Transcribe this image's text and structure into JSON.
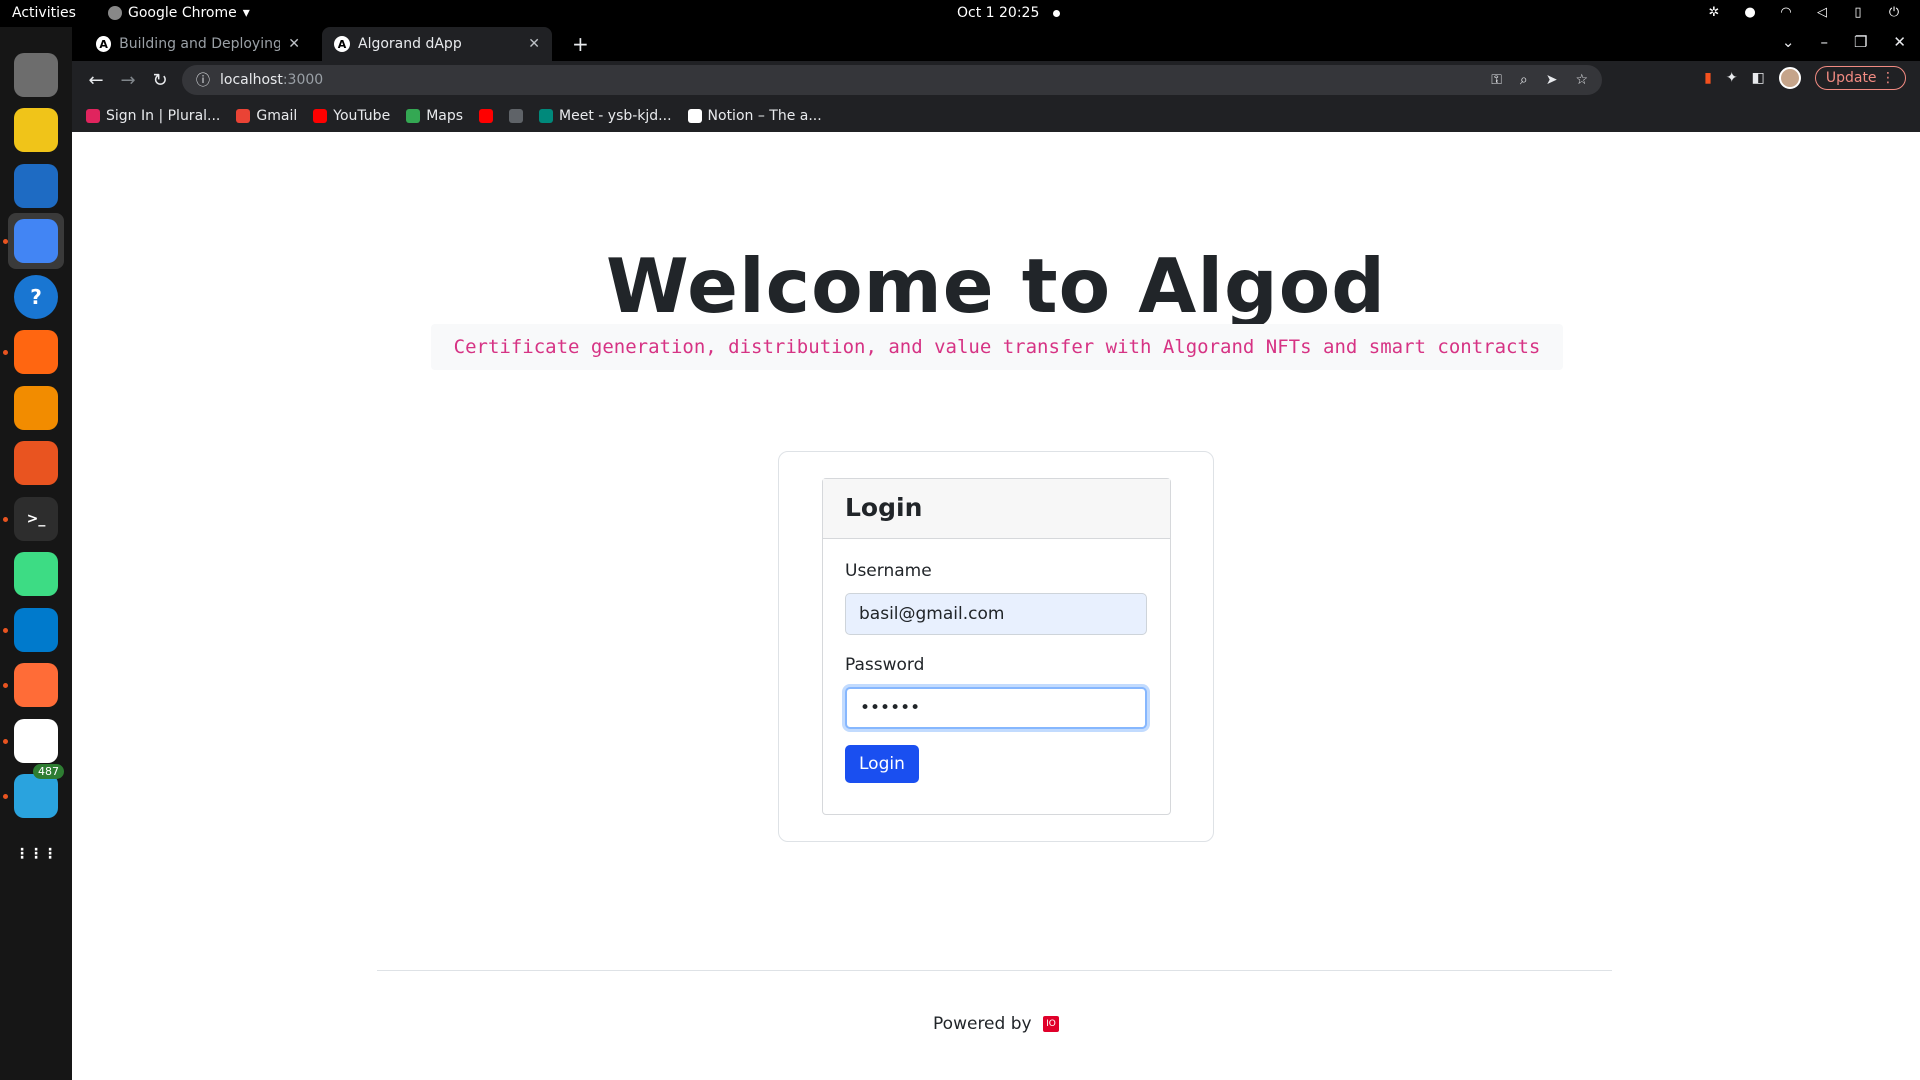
{
  "system": {
    "activities": "Activities",
    "app_name": "Google Chrome",
    "clock": "Oct 1  20:25"
  },
  "dock": {
    "items": [
      {
        "name": "files-icon",
        "color": "#6d6d6d"
      },
      {
        "name": "rhythmbox-icon",
        "color": "#f0c419"
      },
      {
        "name": "libreoffice-writer-icon",
        "color": "#1e6bc3"
      },
      {
        "name": "chrome-icon",
        "color": "#4285f4"
      },
      {
        "name": "help-icon",
        "color": "#1976d2"
      },
      {
        "name": "firefox-icon",
        "color": "#ff6611"
      },
      {
        "name": "vlc-icon",
        "color": "#f28c00"
      },
      {
        "name": "app-center-icon",
        "color": "#e95420"
      },
      {
        "name": "terminal-icon",
        "color": "#2d2d2d"
      },
      {
        "name": "android-studio-icon",
        "color": "#3ddc84"
      },
      {
        "name": "vscode-icon",
        "color": "#007acc"
      },
      {
        "name": "postman-icon",
        "color": "#ff6c37"
      },
      {
        "name": "slack-icon",
        "color": "#ffffff"
      },
      {
        "name": "telegram-icon",
        "color": "#2aa3de"
      },
      {
        "name": "show-apps-icon",
        "color": "#161616"
      }
    ],
    "telegram_badge": "487"
  },
  "browser": {
    "tabs": [
      {
        "title": "Building and Deploying a",
        "active": false
      },
      {
        "title": "Algorand dApp",
        "active": true
      }
    ],
    "url_host": "localhost",
    "url_port": ":3000",
    "update_label": "Update",
    "bookmarks": [
      {
        "label": "Sign In | Plural...",
        "color": "#e0245e"
      },
      {
        "label": "Gmail",
        "color": "#ea4335"
      },
      {
        "label": "YouTube",
        "color": "#ff0000"
      },
      {
        "label": "Maps",
        "color": "#34a853"
      },
      {
        "label": "",
        "color": "#ff0000"
      },
      {
        "label": "",
        "color": "#5f6368"
      },
      {
        "label": "Meet - ysb-kjd...",
        "color": "#00897b"
      },
      {
        "label": "Notion – The a...",
        "color": "#ffffff"
      }
    ]
  },
  "page": {
    "title": "Welcome to Algod",
    "subtitle": "Certificate generation, distribution, and value transfer with Algorand NFTs and smart contracts",
    "login": {
      "header": "Login",
      "username_label": "Username",
      "username_value": "basil@gmail.com",
      "password_label": "Password",
      "password_value": "••••••",
      "submit_label": "Login"
    },
    "footer": {
      "powered_by": "Powered by",
      "logo_text": "IO"
    }
  },
  "colors": {
    "primary": "#1a4ff0",
    "subtitle": "#d63384",
    "accent": "#e95420"
  }
}
